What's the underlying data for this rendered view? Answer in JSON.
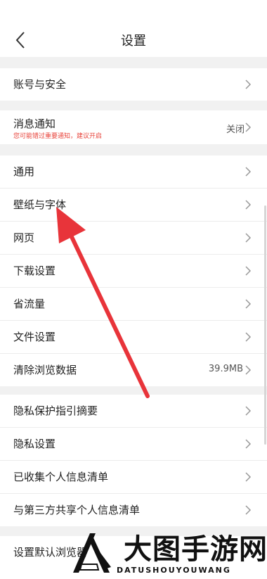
{
  "header": {
    "title": "设置"
  },
  "sections": [
    {
      "items": [
        {
          "label": "账号与安全"
        }
      ]
    },
    {
      "items": [
        {
          "label": "消息通知",
          "sublabel": "您可能错过重要通知，建议开启",
          "value": "关闭"
        }
      ]
    },
    {
      "items": [
        {
          "label": "通用"
        },
        {
          "label": "壁纸与字体"
        },
        {
          "label": "网页"
        },
        {
          "label": "下载设置"
        },
        {
          "label": "省流量"
        },
        {
          "label": "文件设置"
        },
        {
          "label": "清除浏览数据",
          "value": "39.9MB"
        }
      ]
    },
    {
      "items": [
        {
          "label": "隐私保护指引摘要"
        },
        {
          "label": "隐私设置"
        },
        {
          "label": "已收集个人信息清单"
        },
        {
          "label": "与第三方共享个人信息清单"
        }
      ]
    },
    {
      "items": [
        {
          "label": "设置默认浏览器"
        }
      ]
    }
  ],
  "watermark": {
    "title": "大图手游网",
    "subtitle": "DATUSHOUYOUWANG"
  },
  "colors": {
    "background": "#f1f1f1",
    "annotation_arrow": "#e8343a",
    "warning_text": "#e8453c"
  },
  "icons": {
    "back": "chevron-left-icon",
    "row": "chevron-right-icon"
  }
}
